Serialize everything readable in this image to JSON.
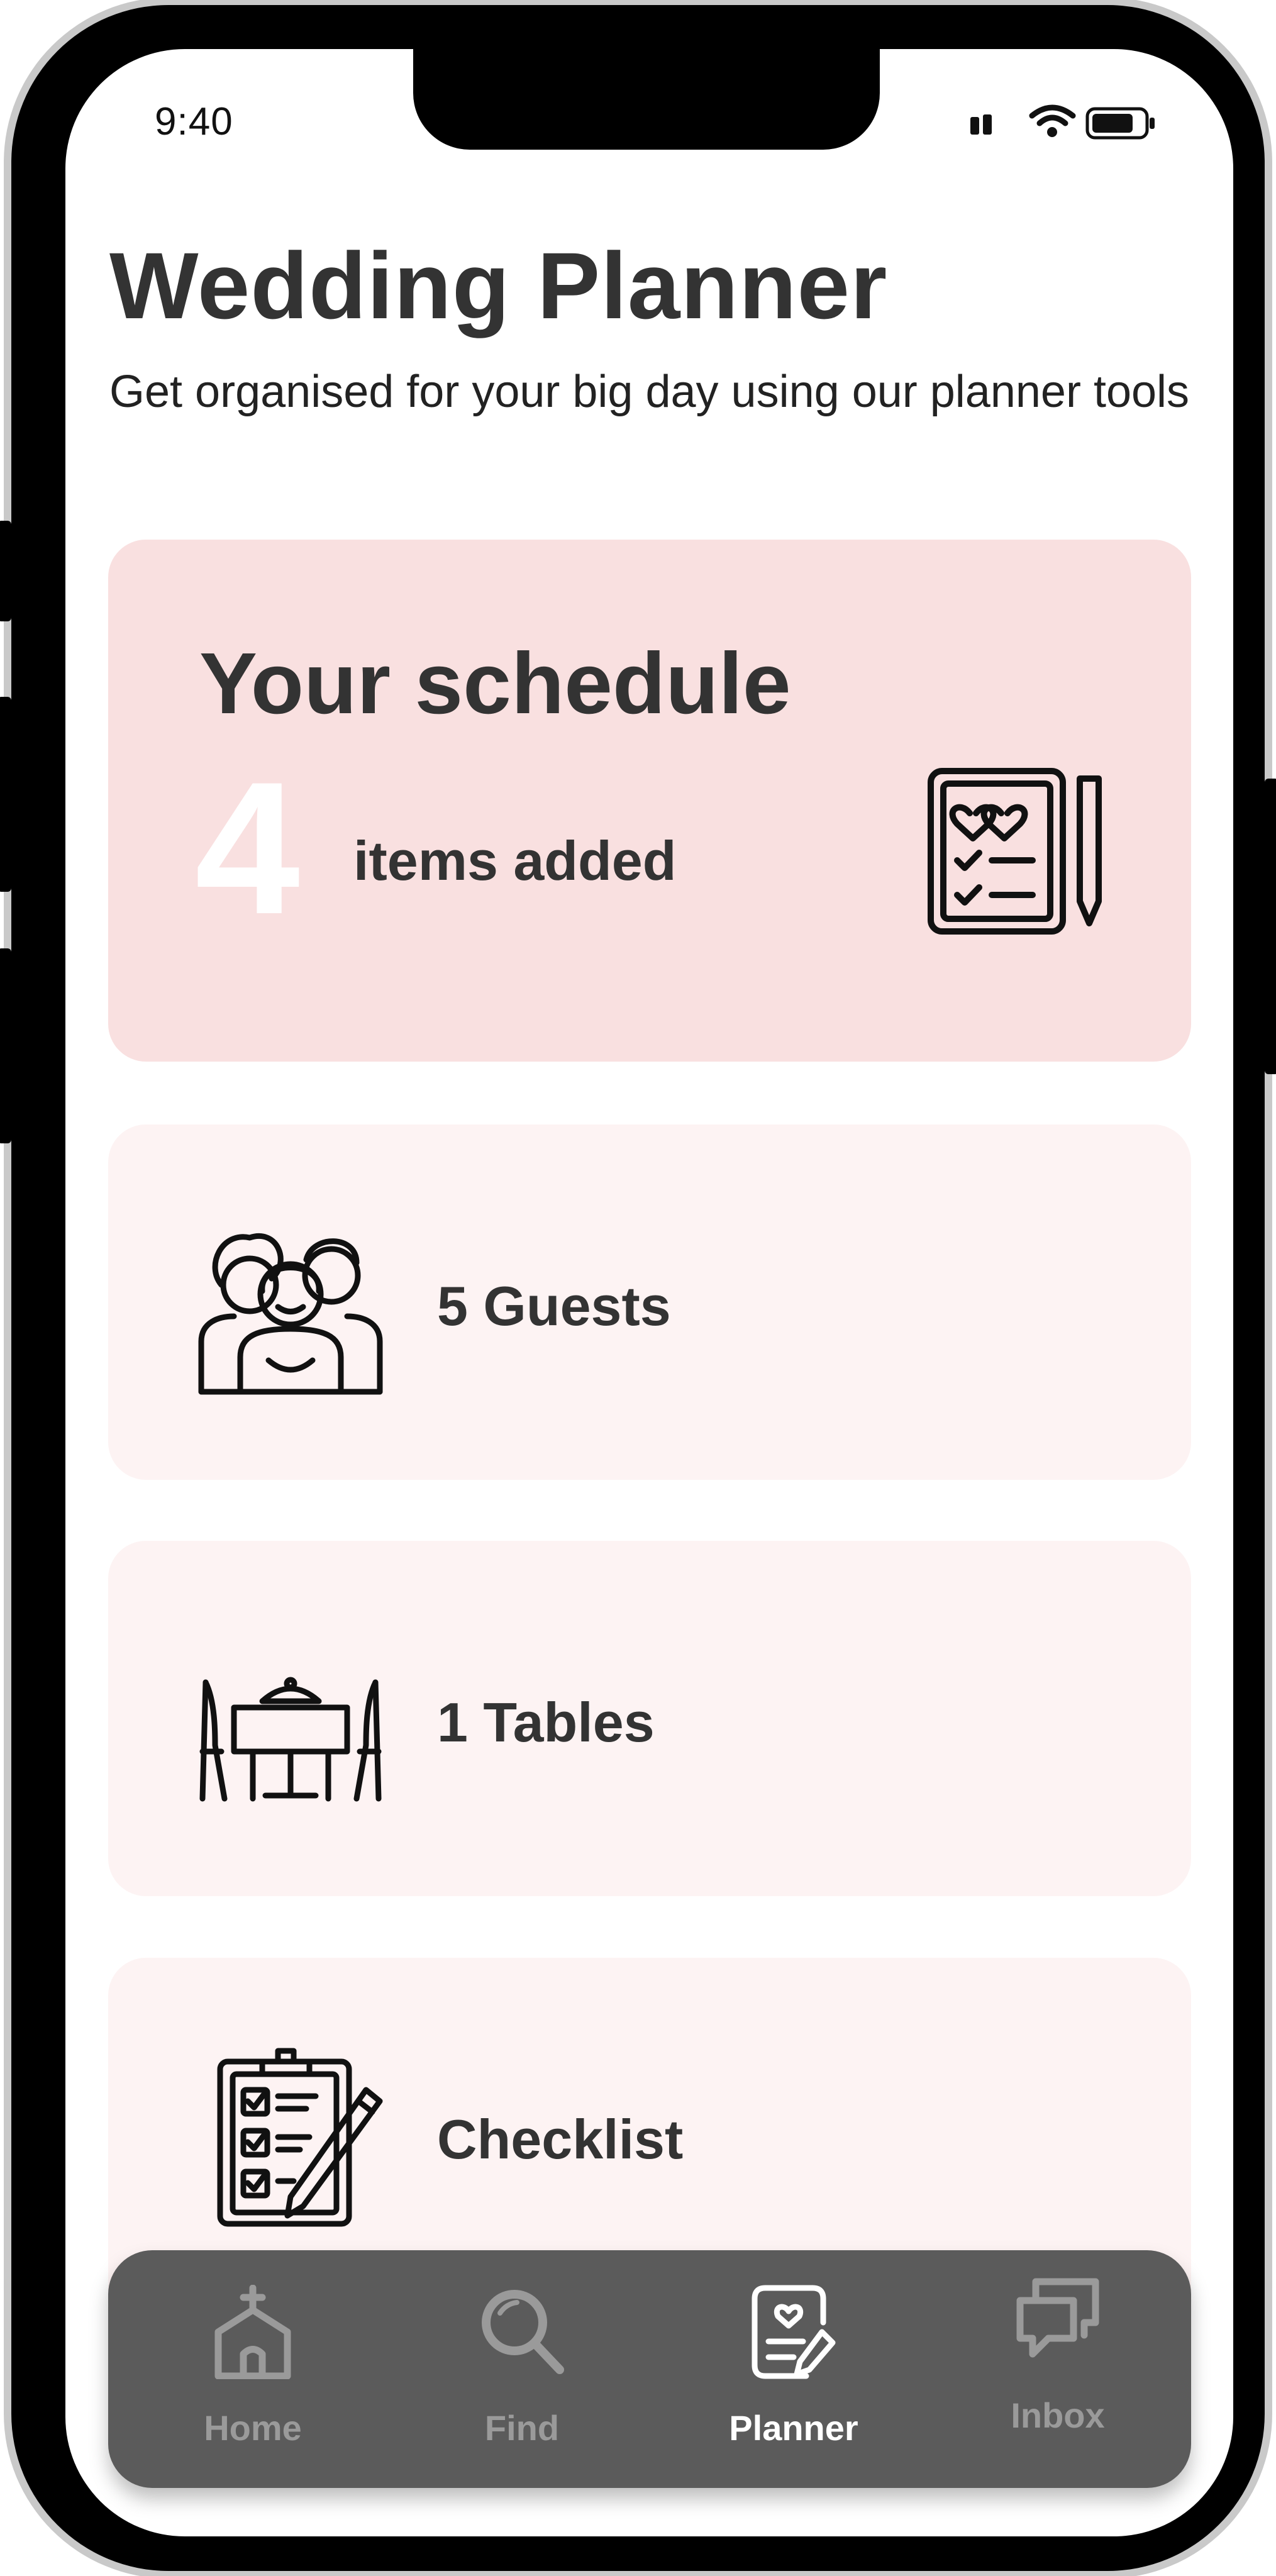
{
  "status_bar": {
    "time": "9:40"
  },
  "header": {
    "title": "Wedding Planner",
    "subtitle": "Get organised for your big day using our planner tools"
  },
  "schedule_card": {
    "title": "Your schedule",
    "count": "4",
    "label": "items added",
    "icon": "wedding-checklist-icon"
  },
  "items": {
    "guests": {
      "label": "5 Guests",
      "icon": "guests-icon"
    },
    "tables": {
      "label": "1 Tables",
      "icon": "table-icon"
    },
    "checklist": {
      "label": "Checklist",
      "icon": "clipboard-checklist-icon"
    }
  },
  "tabs": [
    {
      "label": "Home",
      "icon": "church-icon",
      "active": false
    },
    {
      "label": "Find",
      "icon": "search-icon",
      "active": false
    },
    {
      "label": "Planner",
      "icon": "planner-icon",
      "active": true
    },
    {
      "label": "Inbox",
      "icon": "chat-icon",
      "active": false
    }
  ],
  "colors": {
    "schedule_card_bg": "#f9e0e0",
    "item_card_bg": "#fdf3f3",
    "tabbar_bg": "#5b5b5b",
    "tab_active": "#ffffff",
    "tab_inactive": "#9a9a9a",
    "text": "#333333"
  }
}
